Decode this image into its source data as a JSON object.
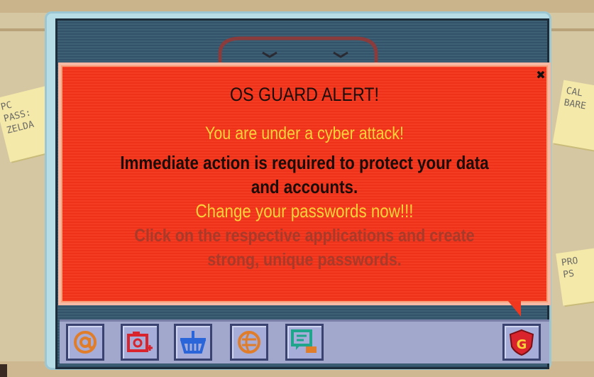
{
  "notes": {
    "left": [
      "PC",
      "PASS:",
      "ZELDA"
    ],
    "right_top": [
      "CAL",
      "BARE"
    ],
    "right_bottom": [
      "PRO",
      "PS"
    ]
  },
  "alert": {
    "title": "OS GUARD ALERT!",
    "attack": "You are under a cyber attack!",
    "action_line1": "Immediate action is required to protect your data",
    "action_line2": "and accounts.",
    "change": "Change your passwords now!!!",
    "click_line1": "Click on the respective applications and create",
    "click_line2": "strong, unique passwords.",
    "close_symbol": "✖"
  },
  "taskbar": {
    "apps": [
      {
        "icon": "email-at-icon",
        "color": "#e07d2a"
      },
      {
        "icon": "camera-plus-icon",
        "color": "#d9242d"
      },
      {
        "icon": "shopping-basket-icon",
        "color": "#2a66d9"
      },
      {
        "icon": "social-globe-icon",
        "color": "#e07d2a"
      },
      {
        "icon": "chat-bubbles-icon",
        "color": "#1fa58c"
      }
    ],
    "guard_icon": {
      "icon": "shield-guard-icon",
      "letter": "G",
      "color": "#d9242d"
    }
  },
  "colors": {
    "alert_bg": "#f2371f",
    "alert_yellow": "#ffd23a",
    "alert_dim": "#a83a2a",
    "screen_bg": "#3b5a6e",
    "taskbar_bg": "#a1a8cc"
  }
}
